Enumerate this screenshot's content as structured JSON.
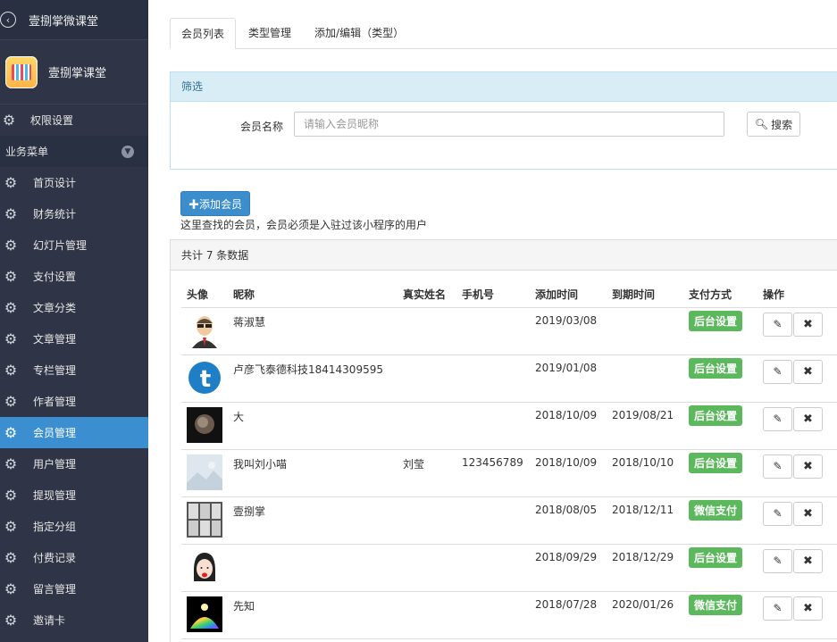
{
  "sidebar": {
    "top_title": "壹捌掌微课堂",
    "brand_name": "壹捌掌课堂",
    "perm_item": "权限设置",
    "section_label": "业务菜单",
    "items": [
      {
        "label": "首页设计"
      },
      {
        "label": "财务统计"
      },
      {
        "label": "幻灯片管理"
      },
      {
        "label": "支付设置"
      },
      {
        "label": "文章分类"
      },
      {
        "label": "文章管理"
      },
      {
        "label": "专栏管理"
      },
      {
        "label": "作者管理"
      },
      {
        "label": "会员管理",
        "active": true
      },
      {
        "label": "用户管理"
      },
      {
        "label": "提现管理"
      },
      {
        "label": "指定分组"
      },
      {
        "label": "付费记录"
      },
      {
        "label": "留言管理"
      },
      {
        "label": "邀请卡"
      }
    ]
  },
  "tabs": [
    {
      "label": "会员列表"
    },
    {
      "label": "类型管理"
    },
    {
      "label": "添加/编辑（类型）"
    }
  ],
  "filter": {
    "title": "筛选",
    "label": "会员名称",
    "placeholder": "请输入会员昵称",
    "search_label": "搜索"
  },
  "add_button": "✚添加会员",
  "hint": "这里查找的会员，会员必须是入驻过该小程序的用户",
  "panel_title": "共计 7 条数据",
  "table": {
    "headers": [
      "头像",
      "昵称",
      "真实姓名",
      "手机号",
      "添加时间",
      "到期时间",
      "支付方式",
      "操作"
    ],
    "rows": [
      {
        "nick": "蒋淑慧",
        "real": "",
        "phone": "",
        "added": "2019/03/08",
        "expire": "",
        "pay": "后台设置"
      },
      {
        "nick": "卢彦飞泰德科技18414309595",
        "real": "",
        "phone": "",
        "added": "2019/01/08",
        "expire": "",
        "pay": "后台设置"
      },
      {
        "nick": "大",
        "real": "",
        "phone": "",
        "added": "2018/10/09",
        "expire": "2019/08/21",
        "pay": "后台设置"
      },
      {
        "nick": "我叫刘小喵",
        "real": "刘莹",
        "phone": "123456789",
        "added": "2018/10/09",
        "expire": "2018/10/10",
        "pay": "后台设置"
      },
      {
        "nick": "壹捌掌",
        "real": "",
        "phone": "",
        "added": "2018/08/05",
        "expire": "2018/12/11",
        "pay": "微信支付"
      },
      {
        "nick": "",
        "real": "",
        "phone": "",
        "added": "2018/09/29",
        "expire": "2018/12/29",
        "pay": "后台设置"
      },
      {
        "nick": "先知",
        "real": "",
        "phone": "",
        "added": "2018/07/28",
        "expire": "2020/01/26",
        "pay": "微信支付"
      }
    ]
  },
  "colors": {
    "sidebar_bg": "#2f3546",
    "active_item": "#3b8fd1",
    "pay_badge": "#5cb85c",
    "add_button": "#3c8dcc"
  }
}
